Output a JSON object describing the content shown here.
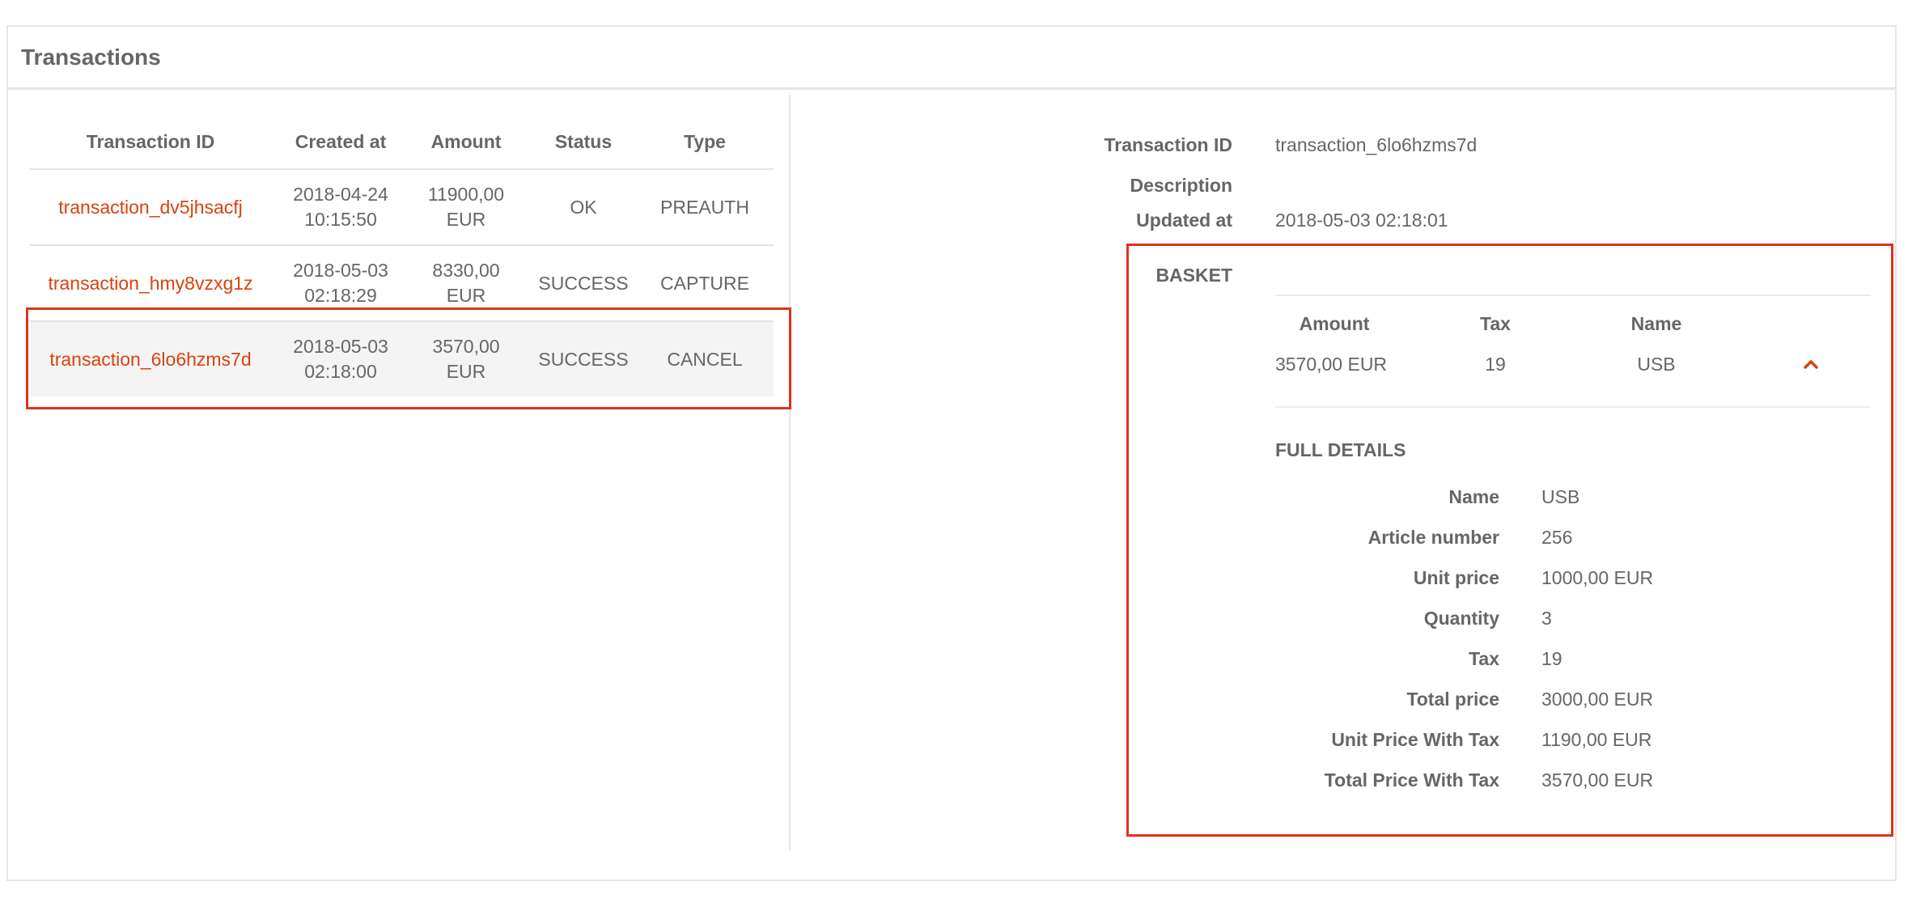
{
  "panel": {
    "title": "Transactions"
  },
  "table": {
    "headers": {
      "id": "Transaction ID",
      "created": "Created at",
      "amount": "Amount",
      "status": "Status",
      "type": "Type"
    },
    "rows": [
      {
        "id": "transaction_dv5jhsacfj",
        "created_date": "2018-04-24",
        "created_time": "10:15:50",
        "amount_value": "11900,00",
        "amount_currency": "EUR",
        "status": "OK",
        "type": "PREAUTH"
      },
      {
        "id": "transaction_hmy8vzxg1z",
        "created_date": "2018-05-03",
        "created_time": "02:18:29",
        "amount_value": "8330,00",
        "amount_currency": "EUR",
        "status": "SUCCESS",
        "type": "CAPTURE"
      },
      {
        "id": "transaction_6lo6hzms7d",
        "created_date": "2018-05-03",
        "created_time": "02:18:00",
        "amount_value": "3570,00",
        "amount_currency": "EUR",
        "status": "SUCCESS",
        "type": "CANCEL"
      }
    ]
  },
  "details": {
    "transaction_id_label": "Transaction ID",
    "transaction_id_value": "transaction_6lo6hzms7d",
    "description_label": "Description",
    "description_value": "",
    "updated_label": "Updated at",
    "updated_value": "2018-05-03 02:18:01",
    "basket_label": "BASKET",
    "basket": {
      "headers": {
        "amount": "Amount",
        "tax": "Tax",
        "name": "Name"
      },
      "row": {
        "amount": "3570,00 EUR",
        "tax": "19",
        "name": "USB"
      }
    },
    "full_details_title": "FULL DETAILS",
    "full_details": [
      {
        "label": "Name",
        "value": "USB"
      },
      {
        "label": "Article number",
        "value": "256"
      },
      {
        "label": "Unit price",
        "value": "1000,00 EUR"
      },
      {
        "label": "Quantity",
        "value": "3"
      },
      {
        "label": "Tax",
        "value": "19"
      },
      {
        "label": "Total price",
        "value": "3000,00 EUR"
      },
      {
        "label": "Unit Price With Tax",
        "value": "1190,00 EUR"
      },
      {
        "label": "Total Price With Tax",
        "value": "3570,00 EUR"
      }
    ]
  },
  "colors": {
    "accent": "#d9420f",
    "highlight": "#e0311d",
    "border": "#e6e6e6",
    "text": "#666666"
  },
  "icons": {
    "collapse": "chevron-up-icon"
  }
}
